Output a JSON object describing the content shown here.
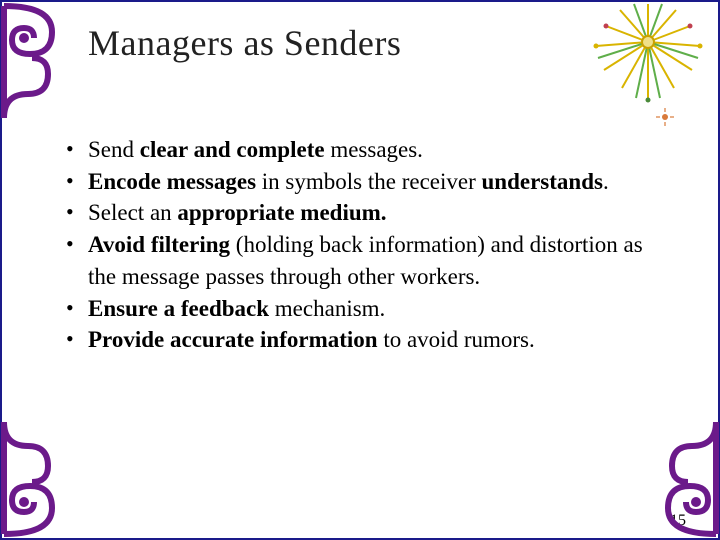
{
  "title": "Managers as Senders",
  "bullets": [
    {
      "pre": "Send ",
      "bold": "clear and complete",
      "post": " messages."
    },
    {
      "pre": "",
      "bold": "Encode messages",
      "post": " in symbols the receiver"
    },
    {
      "pre": "",
      "bold": "understands",
      "post": "."
    },
    {
      "pre": "Select an ",
      "bold": "appropriate medium.",
      "post": ""
    },
    {
      "pre": "",
      "bold": "Avoid filtering",
      "post": " (holding back information) and distortion as the message passes through other workers."
    },
    {
      "pre": "",
      "bold": "Ensure a feedback",
      "post": " mechanism."
    },
    {
      "pre": "",
      "bold": "Provide accurate information",
      "post": " to avoid rumors."
    }
  ],
  "page_number": "15"
}
